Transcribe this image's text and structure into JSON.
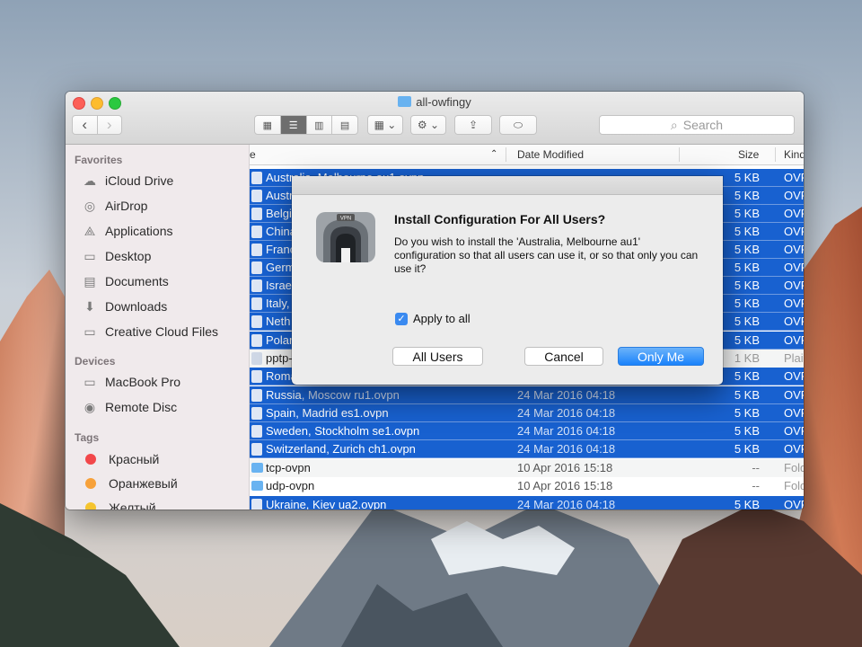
{
  "window": {
    "title": "all-owfingy"
  },
  "toolbar": {
    "search_placeholder": "Search"
  },
  "sidebar": {
    "favorites_header": "Favorites",
    "favorites": [
      "iCloud Drive",
      "AirDrop",
      "Applications",
      "Desktop",
      "Documents",
      "Downloads",
      "Creative Cloud Files"
    ],
    "devices_header": "Devices",
    "devices": [
      "MacBook Pro",
      "Remote Disc"
    ],
    "tags_header": "Tags",
    "tags": [
      {
        "label": "Красный",
        "color": "#f2474a"
      },
      {
        "label": "Оранжевый",
        "color": "#f7a13a"
      },
      {
        "label": "Желтый",
        "color": "#f5c42e"
      }
    ]
  },
  "columns": {
    "name": "e",
    "date": "Date Modified",
    "size": "Size",
    "kind": "Kind"
  },
  "files": [
    {
      "name": "Russia",
      "sub": ", Moscow ru1.ovpn",
      "date": "24 Mar 2016 04:18",
      "size": "5 KB",
      "kind": "OVP"
    },
    {
      "name": "Spain, Madrid es1.ovpn",
      "sub": "",
      "date": "24 Mar 2016 04:18",
      "size": "5 KB",
      "kind": "OVP"
    },
    {
      "name": "Sweden, Stockholm se1.ovpn",
      "sub": "",
      "date": "24 Mar 2016 04:18",
      "size": "5 KB",
      "kind": "OVP"
    },
    {
      "name": "Switzerland, Zurich ch1.ovpn",
      "sub": "",
      "date": "24 Mar 2016 04:18",
      "size": "5 KB",
      "kind": "OVP"
    },
    {
      "name": "tcp-ovpn",
      "sub": "",
      "date": "10 Apr 2016 15:18",
      "size": "--",
      "kind": "Fold"
    },
    {
      "name": "udp-ovpn",
      "sub": "",
      "date": "10 Apr 2016 15:18",
      "size": "--",
      "kind": "Fold"
    },
    {
      "name": "Ukraine, Kiev ua2.ovpn",
      "sub": "",
      "date": "24 Mar 2016 04:18",
      "size": "5 KB",
      "kind": "OVP"
    }
  ],
  "partial_rows": [
    {
      "name": "Australia, Melbourne au1.ovpn",
      "size": "5 KB",
      "kind": "OVP"
    },
    {
      "name": "Austr",
      "size": "5 KB",
      "kind": "OVP"
    },
    {
      "name": "Belgi",
      "size": "5 KB",
      "kind": "OVP"
    },
    {
      "name": "China",
      "size": "5 KB",
      "kind": "OVP"
    },
    {
      "name": "Franc",
      "size": "5 KB",
      "kind": "OVP"
    },
    {
      "name": "Germ",
      "size": "5 KB",
      "kind": "OVP"
    },
    {
      "name": "Israe",
      "size": "5 KB",
      "kind": "OVP"
    },
    {
      "name": "Italy,",
      "size": "5 KB",
      "kind": "OVP"
    },
    {
      "name": "Neth",
      "size": "5 KB",
      "kind": "OVP"
    },
    {
      "name": "Polar",
      "size": "5 KB",
      "kind": "OVP"
    },
    {
      "name": "pptp-",
      "size": "1 KB",
      "kind": "Plai"
    },
    {
      "name": "Roma",
      "size": "5 KB",
      "kind": "OVP"
    }
  ],
  "dialog": {
    "icon_label": "VPN",
    "title": "Install Configuration For All Users?",
    "message": "Do you wish to install the 'Australia, Melbourne au1' configuration so that all users can use it, or so that only you can use it?",
    "checkbox_label": "Apply to all",
    "btn_all_users": "All Users",
    "btn_cancel": "Cancel",
    "btn_only_me": "Only Me"
  },
  "colors": {
    "selection": "#1861d0",
    "primary_button": "#1a82fb"
  }
}
